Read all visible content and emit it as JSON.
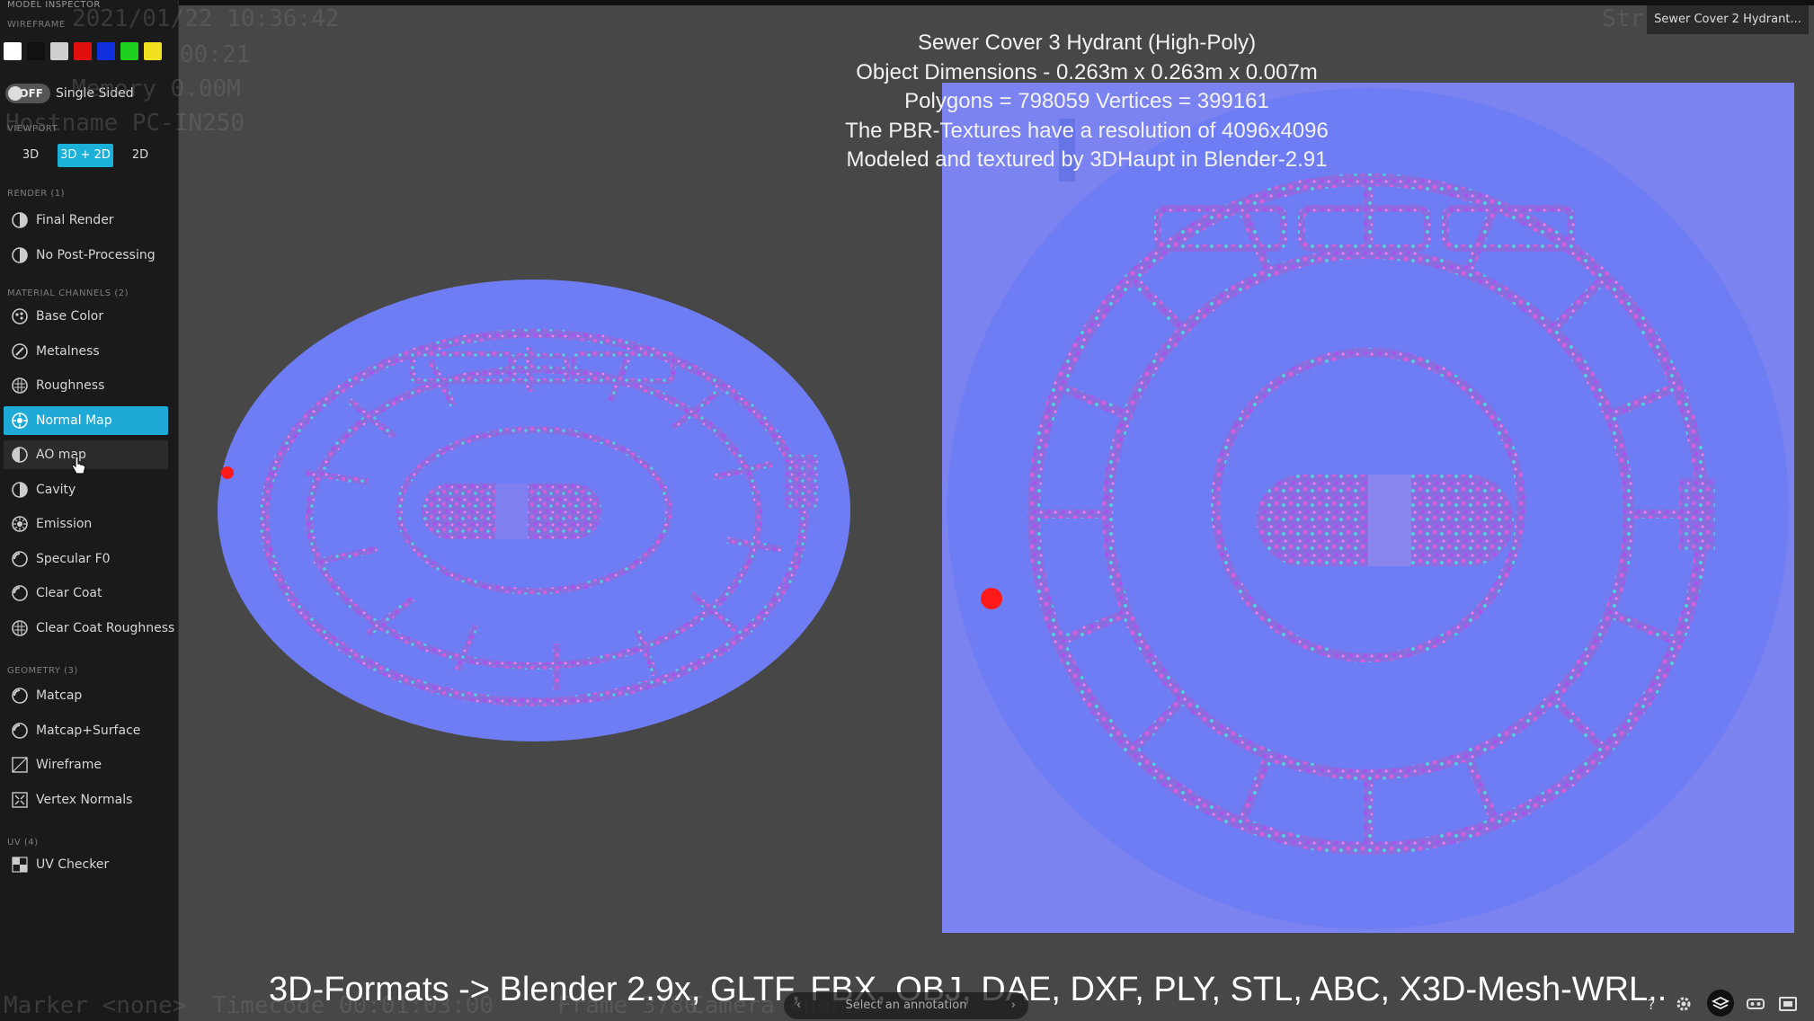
{
  "sidebar": {
    "title": "Model Inspector",
    "wireframe_header": "WIREFRAME",
    "wireframe_swatches": [
      "#ffffff",
      "#111111",
      "#cfcfcf",
      "#e01010",
      "#1030e0",
      "#20d020",
      "#f0e020"
    ],
    "toggle": {
      "state": "OFF",
      "label": "Single Sided"
    },
    "viewport_header": "VIEWPORT",
    "viewport_buttons": [
      "3D",
      "3D + 2D",
      "2D"
    ],
    "viewport_active": "3D + 2D",
    "render_header": "RENDER (1)",
    "render_items": [
      {
        "label": "Final Render",
        "icon": "render-icon"
      },
      {
        "label": "No Post-Processing",
        "icon": "render-icon"
      }
    ],
    "material_header": "MATERIAL CHANNELS (2)",
    "material_items": [
      {
        "label": "Base Color",
        "icon": "base-color-icon"
      },
      {
        "label": "Metalness",
        "icon": "metalness-icon"
      },
      {
        "label": "Roughness",
        "icon": "roughness-icon"
      },
      {
        "label": "Normal Map",
        "icon": "normal-map-icon",
        "selected": true
      },
      {
        "label": "AO map",
        "icon": "ao-map-icon",
        "hover": true
      },
      {
        "label": "Cavity",
        "icon": "cavity-icon"
      },
      {
        "label": "Emission",
        "icon": "emission-icon"
      },
      {
        "label": "Specular F0",
        "icon": "specular-icon"
      },
      {
        "label": "Clear Coat",
        "icon": "clear-coat-icon"
      },
      {
        "label": "Clear Coat Roughness",
        "icon": "clear-coat-roughness-icon"
      }
    ],
    "geometry_header": "GEOMETRY (3)",
    "geometry_items": [
      {
        "label": "Matcap",
        "icon": "matcap-icon"
      },
      {
        "label": "Matcap+Surface",
        "icon": "matcap-surface-icon"
      },
      {
        "label": "Wireframe",
        "icon": "wireframe-icon"
      },
      {
        "label": "Vertex Normals",
        "icon": "vertex-normals-icon"
      }
    ],
    "uv_header": "UV (4)",
    "uv_items": [
      {
        "label": "UV Checker",
        "icon": "uv-checker-icon"
      }
    ]
  },
  "overlay_ghost": {
    "date": "2021/01/22 10:36:42",
    "time": "00:21",
    "memory": "Memory 0.00M",
    "hostname": "Hostname PC-IN250",
    "stats": "Str",
    "marker": "Marker <none>",
    "timecode": "Timecode 00:01:03:00",
    "frame": "Frame 3780",
    "camera": "Camera <none>"
  },
  "viewport": {
    "info_lines": [
      "Sewer Cover 3 Hydrant (High-Poly)",
      "Object Dimensions - 0.263m x 0.263m x 0.007m",
      "Polygons = 798059  Vertices = 399161",
      "The PBR-Textures have a resolution of 4096x4096",
      "Modeled and textured by 3DHaupt in Blender-2.91"
    ],
    "formats_caption": "3D-Formats -> Blender 2.9x, GLTF, FBX, OBJ, DAE, DXF, PLY, STL, ABC, X3D-Mesh-WRL..",
    "model_tab": "Sewer Cover 2 Hydrant...",
    "annotation_placeholder": "Select an annotation",
    "annot_prev": "‹",
    "annot_next": "›",
    "colors": {
      "normal_base": "#6f7df4",
      "normal_bg_2d": "#7b83f0",
      "hotspot": "#ff1a1a"
    }
  }
}
